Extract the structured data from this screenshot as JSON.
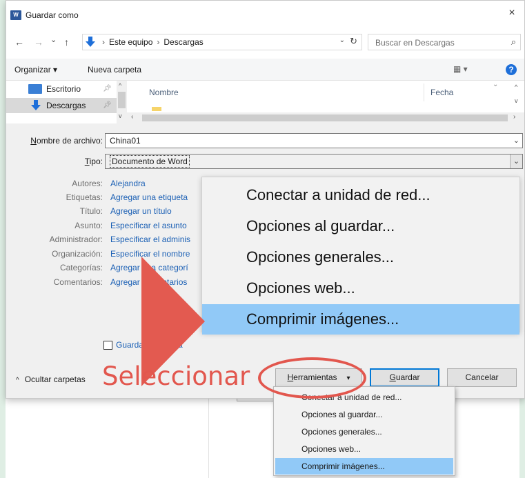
{
  "window": {
    "title": "Guardar como",
    "app_icon": "word-icon",
    "close_label": "×"
  },
  "nav": {
    "back": "←",
    "forward": "→",
    "history": "⌄",
    "up": "↑",
    "breadcrumbs": [
      "Este equipo",
      "Descargas"
    ],
    "refresh": "↻",
    "search_placeholder": "Buscar en Descargas",
    "search_icon": "⌕"
  },
  "commandbar": {
    "organize": "Organizar ▾",
    "new_folder": "Nueva carpeta",
    "view": "▦ ▾",
    "help": "?"
  },
  "sidebar": {
    "items": [
      {
        "label": "Escritorio",
        "icon": "desktop-folder-icon"
      },
      {
        "label": "Descargas",
        "icon": "download-arrow-icon",
        "selected": true
      }
    ]
  },
  "file_list": {
    "columns": [
      "Nombre",
      "Fecha"
    ]
  },
  "form": {
    "filename_label_prefix": "N",
    "filename_label_rest": "ombre de archivo:",
    "filename_value": "China01",
    "type_label_prefix": "T",
    "type_label_rest": "ipo:",
    "type_value": "Documento de Word"
  },
  "metadata": [
    {
      "label": "Autores:",
      "value": "Alejandra"
    },
    {
      "label": "Etiquetas:",
      "value": "Agregar una etiqueta"
    },
    {
      "label": "Título:",
      "value": "Agregar un título"
    },
    {
      "label": "Asunto:",
      "value": "Especificar el asunto"
    },
    {
      "label": "Administrador:",
      "value": "Especificar el adminis"
    },
    {
      "label": "Organización:",
      "value": "Especificar el nombre"
    },
    {
      "label": "Categorías:",
      "value": "Agregar una categorí"
    },
    {
      "label": "Comentarios:",
      "value": "Agregar comentarios"
    }
  ],
  "thumbnail_checkbox": {
    "label": "Guardar miniatura",
    "checked": false
  },
  "footer": {
    "hide_folders": "Ocultar carpetas",
    "tools_prefix": "H",
    "tools_rest": "erramientas",
    "tools_caret": "▾",
    "save_prefix": "G",
    "save_rest": "uardar",
    "cancel": "Cancelar"
  },
  "tools_menu_zoom": {
    "items": [
      "Conectar a unidad de red...",
      "Opciones al guardar...",
      "Opciones generales...",
      "Opciones web...",
      "Comprimir imágenes..."
    ],
    "highlighted_index": 4
  },
  "tools_menu": {
    "items": [
      "Conectar a unidad de red...",
      "Opciones al guardar...",
      "Opciones generales...",
      "Opciones web...",
      "Comprimir imágenes..."
    ],
    "highlighted_index": 4
  },
  "annotation": {
    "text": "Seleccionar",
    "color": "#e2574e"
  },
  "colors": {
    "highlight": "#91c9f7",
    "link": "#1a5fb4",
    "accent": "#0078d7",
    "background": "#dfeee4"
  }
}
